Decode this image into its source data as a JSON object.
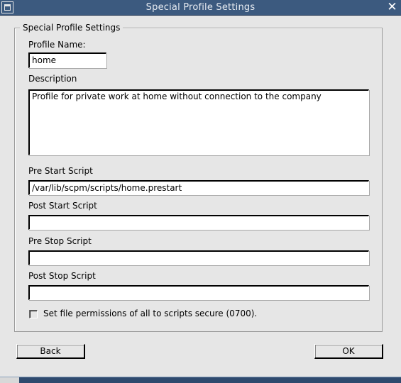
{
  "window": {
    "title": "Special Profile Settings",
    "close_glyph": "✕"
  },
  "group": {
    "title": "Special Profile Settings"
  },
  "profile_name": {
    "label": "Profile Name:",
    "value": "home"
  },
  "description": {
    "label": "Description",
    "value": "Profile for private work at home without connection to the company"
  },
  "pre_start": {
    "label": "Pre Start Script",
    "value": "/var/lib/scpm/scripts/home.prestart"
  },
  "post_start": {
    "label": "Post Start Script",
    "value": ""
  },
  "pre_stop": {
    "label": "Pre Stop Script",
    "value": ""
  },
  "post_stop": {
    "label": "Post Stop Script",
    "value": ""
  },
  "permissions": {
    "label": "Set file permissions of all to scripts secure (0700).",
    "checked": false
  },
  "buttons": {
    "back": "Back",
    "ok": "OK"
  },
  "icons": {
    "window_menu": "window-menu-icon",
    "close": "close-icon",
    "checkbox": "checkbox-icon"
  },
  "colors": {
    "titlebar": "#3c5a7f",
    "background": "#e6e6e6"
  }
}
